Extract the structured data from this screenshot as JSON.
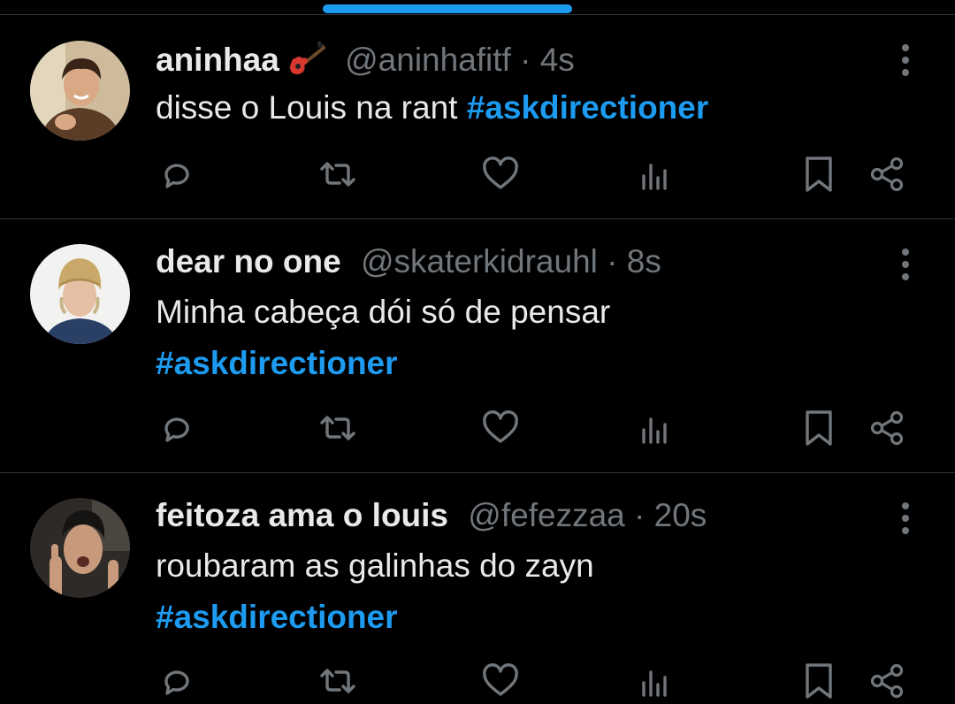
{
  "theme": {
    "accent": "#1d9bf0",
    "background": "#000000",
    "muted": "#71767b",
    "text": "#e7e9ea"
  },
  "tweets": [
    {
      "name": "aninhaa",
      "emoji": "guitar-emoji",
      "handle": "@aninhafitf",
      "separator": "·",
      "time": "4s",
      "text": "disse o Louis na rant ",
      "hashtag": "#askdirectioner"
    },
    {
      "name": "dear no one",
      "handle": "@skaterkidrauhl",
      "separator": "·",
      "time": "8s",
      "text": "Minha cabeça dói só de pensar",
      "hashtag": "#askdirectioner"
    },
    {
      "name": "feitoza ama o louis",
      "handle": "@fefezzaa",
      "separator": "·",
      "time": "20s",
      "text": "roubaram as galinhas do zayn",
      "hashtag": "#askdirectioner"
    }
  ],
  "actions": [
    "reply-icon",
    "retweet-icon",
    "like-icon",
    "views-icon",
    "bookmark-icon",
    "share-icon"
  ]
}
